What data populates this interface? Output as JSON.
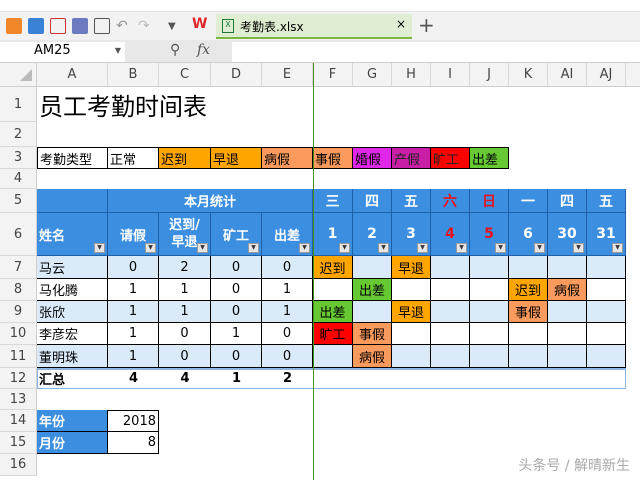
{
  "toolbar": {
    "icons": [
      "open-icon",
      "save-icon",
      "export-pdf-icon",
      "print-icon",
      "print-preview-icon",
      "undo-icon",
      "redo-icon",
      "more-dropdown-icon"
    ],
    "wps_logo": "W",
    "tab_title": "考勤表.xlsx",
    "close": "×",
    "new_tab": "+"
  },
  "formula_bar": {
    "name_box": "AM25",
    "zoom_icon": "⚲",
    "fx": "fx",
    "value": ""
  },
  "columns": [
    "A",
    "B",
    "C",
    "D",
    "E",
    "F",
    "G",
    "H",
    "I",
    "J",
    "K",
    "AI",
    "AJ"
  ],
  "row_numbers": [
    "1",
    "2",
    "3",
    "4",
    "5",
    "6",
    "7",
    "8",
    "9",
    "10",
    "11",
    "12",
    "13",
    "14",
    "15",
    "16"
  ],
  "title": "员工考勤时间表",
  "legend": {
    "label": "考勤类型",
    "types": [
      {
        "name": "正常",
        "color": "#ffffff"
      },
      {
        "name": "迟到",
        "color": "#ffa500"
      },
      {
        "name": "早退",
        "color": "#ffa500"
      },
      {
        "name": "病假",
        "color": "#fa9a5c"
      },
      {
        "name": "事假",
        "color": "#fa9a5c"
      },
      {
        "name": "婚假",
        "color": "#e028e8"
      },
      {
        "name": "产假",
        "color": "#c81fa6"
      },
      {
        "name": "旷工",
        "color": "#ff0000"
      },
      {
        "name": "出差",
        "color": "#66c832"
      }
    ]
  },
  "stats_header": "本月统计",
  "headers": {
    "name": "姓名",
    "leave": "请假",
    "late": "迟到/早退",
    "absent": "矿工",
    "trip": "出差"
  },
  "days": [
    {
      "col": "F",
      "weekday": "三",
      "day": "1",
      "weekend": false
    },
    {
      "col": "G",
      "weekday": "四",
      "day": "2",
      "weekend": false
    },
    {
      "col": "H",
      "weekday": "五",
      "day": "3",
      "weekend": false
    },
    {
      "col": "I",
      "weekday": "六",
      "day": "4",
      "weekend": true
    },
    {
      "col": "J",
      "weekday": "日",
      "day": "5",
      "weekend": true
    },
    {
      "col": "K",
      "weekday": "一",
      "day": "6",
      "weekend": false
    },
    {
      "col": "AI",
      "weekday": "四",
      "day": "30",
      "weekend": false
    },
    {
      "col": "AJ",
      "weekday": "五",
      "day": "31",
      "weekend": false
    }
  ],
  "employees": [
    {
      "name": "马云",
      "stats": [
        "0",
        "2",
        "0",
        "0"
      ],
      "marks": {
        "F": "迟到",
        "H": "早退"
      }
    },
    {
      "name": "马化腾",
      "stats": [
        "1",
        "1",
        "0",
        "1"
      ],
      "marks": {
        "G": "出差",
        "K": "迟到",
        "AI": "病假"
      }
    },
    {
      "name": "张欣",
      "stats": [
        "1",
        "1",
        "0",
        "1"
      ],
      "marks": {
        "F": "出差",
        "H": "早退",
        "K": "事假"
      }
    },
    {
      "name": "李彦宏",
      "stats": [
        "1",
        "0",
        "1",
        "0"
      ],
      "marks": {
        "F": "旷工",
        "G": "事假"
      }
    },
    {
      "name": "董明珠",
      "stats": [
        "1",
        "0",
        "0",
        "0"
      ],
      "marks": {
        "G": "病假"
      }
    }
  ],
  "summary": {
    "label": "汇总",
    "values": [
      "4",
      "4",
      "1",
      "2"
    ]
  },
  "year": {
    "label": "年份",
    "value": "2018"
  },
  "month": {
    "label": "月份",
    "value": "8"
  },
  "watermark": "头条号 / 解晴新生",
  "colors": {
    "header_blue": "#3b8ee0",
    "row_alt": "#dbeaf8",
    "weekend_red": "#e8101a"
  }
}
